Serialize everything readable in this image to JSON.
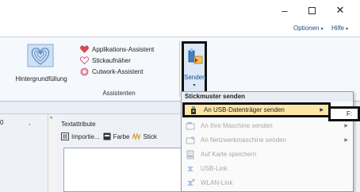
{
  "window": {
    "minimize_glyph": "–",
    "close_glyph": "✕"
  },
  "menu": {
    "options_label": "Optionen",
    "help_label": "Hilfe"
  },
  "ribbon": {
    "background_fill_label": "Hintergrundfüllung",
    "applique_wizard_label": "Applikations-Assistent",
    "patch_label": "Stickaufnäher",
    "cutwork_wizard_label": "Cutwork-Assistent",
    "group_label": "Assistenten",
    "send_label": "Senden"
  },
  "panel": {
    "col_a": "0",
    "col_b": ",",
    "text_attributes_title": "Textattribute",
    "import_label": "Importie...",
    "color_label": "Farbe",
    "stitch_label": "Stick"
  },
  "dropdown": {
    "header": "Stickmuster senden",
    "items": [
      {
        "label": "An USB-Datenträger senden",
        "state": "active",
        "submenu": true,
        "icon": "usb-icon"
      },
      {
        "label": "An Ihre Maschine senden",
        "state": "disabled",
        "submenu": true,
        "icon": "machine-icon"
      },
      {
        "label": "An Netzwerkmaschine senden",
        "state": "disabled",
        "submenu": true,
        "icon": "network-machine-icon"
      },
      {
        "label": "Auf Karte speichern",
        "state": "disabled",
        "submenu": false,
        "icon": "card-icon"
      },
      {
        "label": "USB-Link",
        "state": "disabled",
        "submenu": false,
        "icon": "usb-link-icon"
      },
      {
        "label": "WLAN-Link",
        "state": "disabled",
        "submenu": false,
        "icon": "wlan-link-icon"
      }
    ],
    "submenu_text": "F:"
  },
  "colors": {
    "highlight": "#fde7a8",
    "accent_text": "#1a4d80",
    "heart_red": "#e0474c"
  }
}
